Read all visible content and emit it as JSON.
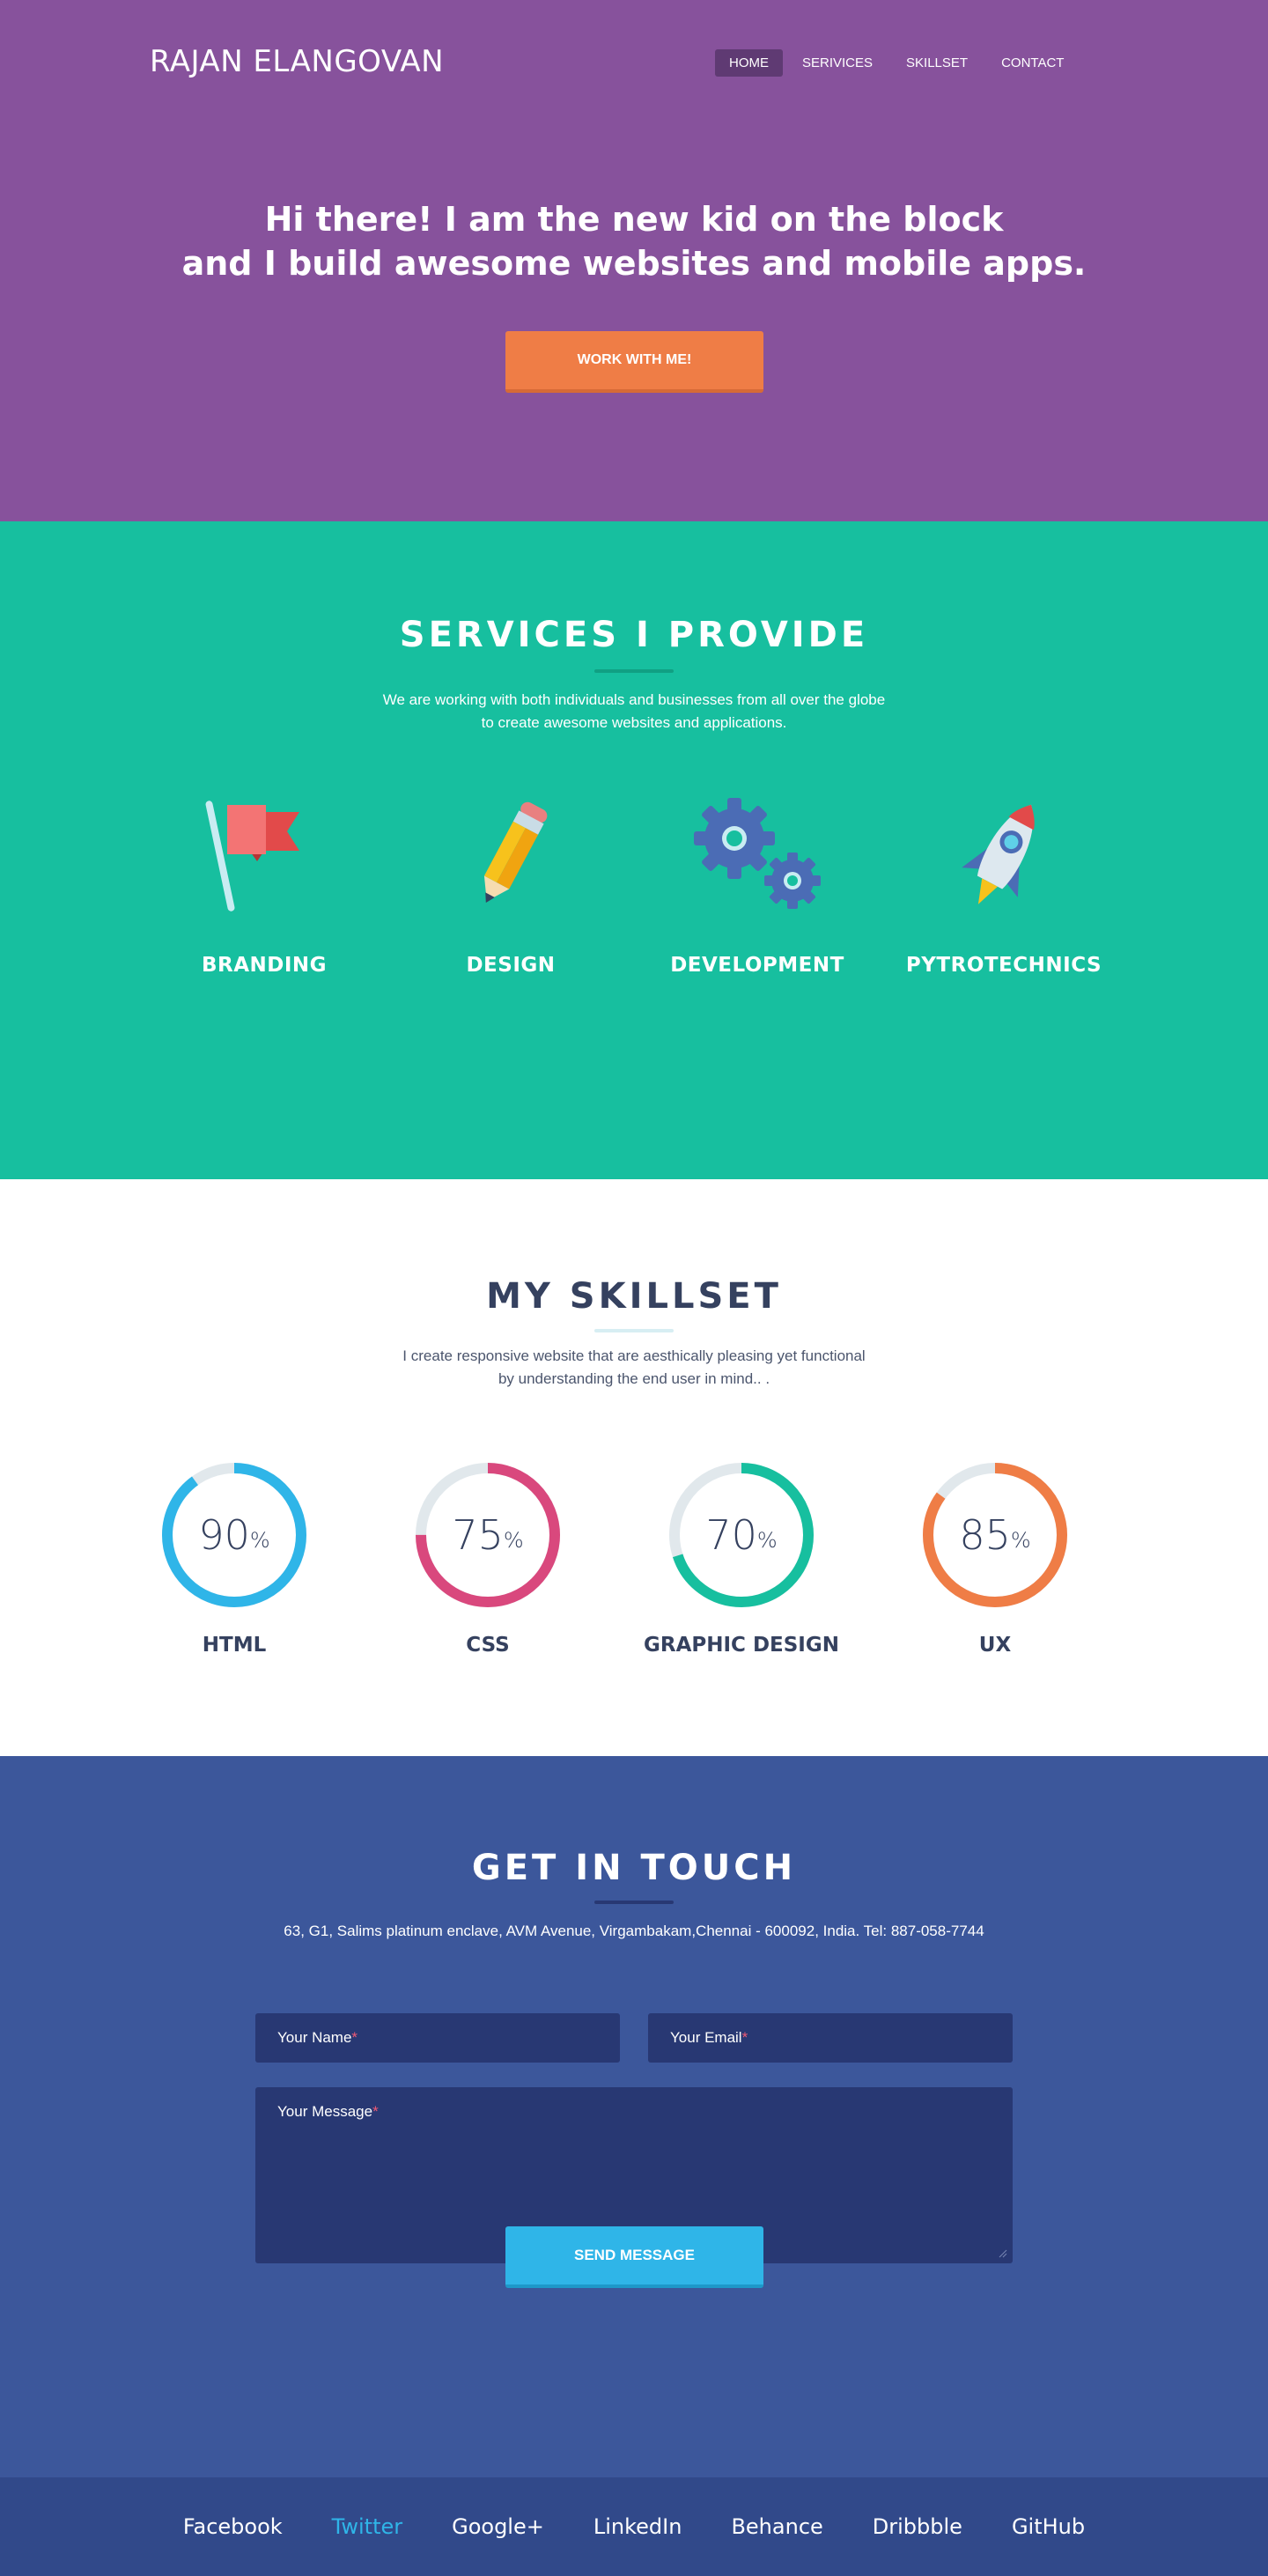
{
  "brand": {
    "name": "RAJAN ELANGOVAN"
  },
  "nav": {
    "items": [
      "HOME",
      "SERIVICES",
      "SKILLSET",
      "CONTACT"
    ],
    "active": "HOME"
  },
  "hero": {
    "line1": "Hi there! I am the new kid on the block",
    "line2": "and I build awesome websites and mobile apps.",
    "cta": "WORK WITH ME!"
  },
  "services": {
    "title": "SERVICES I PROVIDE",
    "subtitle_line1": "We are working with both individuals and businesses from all over the globe",
    "subtitle_line2": "to create awesome websites and applications.",
    "items": [
      {
        "label": "BRANDING",
        "icon": "flag-icon"
      },
      {
        "label": "DESIGN",
        "icon": "pencil-icon"
      },
      {
        "label": "DEVELOPMENT",
        "icon": "gears-icon"
      },
      {
        "label": "PYTROTECHNICS",
        "icon": "rocket-icon"
      }
    ]
  },
  "skills": {
    "title": "MY SKILLSET",
    "subtitle_line1": "I create responsive website that are aesthically pleasing  yet functional",
    "subtitle_line2": "by understanding the end user in mind.. .",
    "items": [
      {
        "label": "HTML",
        "value": "90",
        "unit": "%",
        "percent": 90,
        "color": "#2fb5e8"
      },
      {
        "label": "CSS",
        "value": "75",
        "unit": "%",
        "percent": 75,
        "color": "#d9487d"
      },
      {
        "label": "GRAPHIC DESIGN",
        "value": "70",
        "unit": "%",
        "percent": 70,
        "color": "#17bf9f"
      },
      {
        "label": "UX",
        "value": "85",
        "unit": "%",
        "percent": 85,
        "color": "#ef7d46"
      }
    ]
  },
  "contact": {
    "title": "GET IN TOUCH",
    "address": "63, G1, Salims platinum enclave, AVM Avenue, Virgambakam,Chennai - 600092, India. Tel: 887-058-7744",
    "name_placeholder": "Your Name",
    "email_placeholder": "Your Email",
    "message_placeholder": "Your Message",
    "required_mark": "*",
    "send": "SEND MESSAGE"
  },
  "footer": {
    "links": [
      "Facebook",
      "Twitter",
      "Google+",
      "LinkedIn",
      "Behance",
      "Dribbble",
      "GitHub"
    ],
    "highlighted": "Twitter"
  },
  "colors": {
    "hero_bg": "#87529c",
    "services_bg": "#17bf9f",
    "contact_bg": "#3c579b",
    "footer_bg": "#31498a",
    "accent_orange": "#ef7d46",
    "accent_blue": "#2fb5e8",
    "dark_text": "#35415f"
  }
}
